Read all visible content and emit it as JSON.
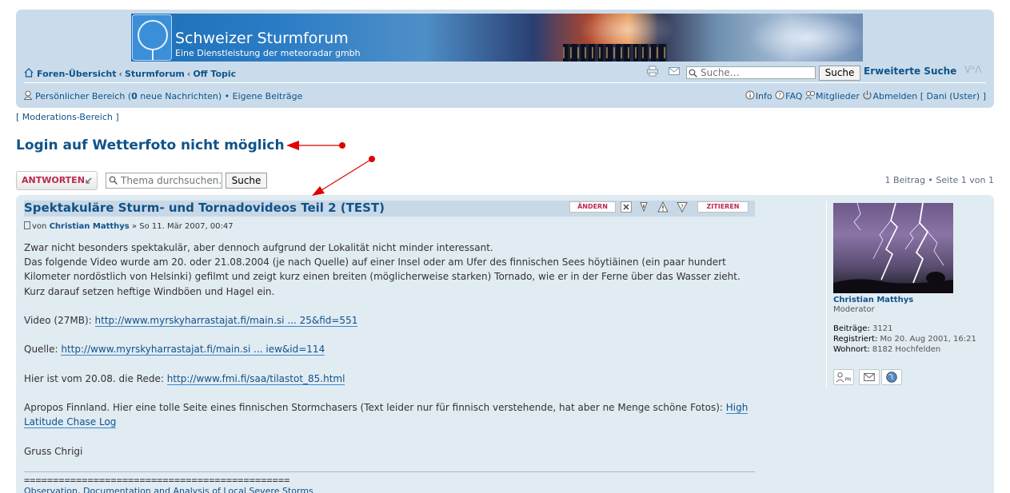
{
  "header": {
    "site_title": "Schweizer Sturmforum",
    "site_subtitle": "Eine Dienstleistung der meteoradar gmbh"
  },
  "breadcrumbs": {
    "home": "Foren-Übersicht",
    "sep": "‹",
    "forum": "Sturmforum",
    "subforum": "Off Topic"
  },
  "search": {
    "placeholder": "Suche…",
    "button": "Suche",
    "advanced": "Erweiterte Suche",
    "fontsize": "ᐯᴬᐱ"
  },
  "userbar": {
    "personal_area_prefix": "Persönlicher Bereich (",
    "new_messages_count": "0",
    "personal_area_suffix": " neue Nachrichten)",
    "bullet": " • ",
    "own_posts": "Eigene Beiträge",
    "info": "Info",
    "faq": "FAQ",
    "members": "Mitglieder",
    "logout": "Abmelden [ Dani (Uster) ]"
  },
  "moderation": "[ Moderations-Bereich ]",
  "topic": {
    "title": "Login auf Wetterfoto nicht möglich",
    "reply_button": "ANTWORTEN",
    "search_placeholder": "Thema durchsuchen…",
    "search_button": "Suche",
    "pagination": "1 Beitrag • Seite 1 von 1"
  },
  "post": {
    "title": "Spektakuläre Sturm- und Tornadovideos Teil 2 (TEST)",
    "buttons": {
      "edit": "ÄNDERN",
      "quote": "ZITIEREN"
    },
    "meta_prefix": "von ",
    "author": "Christian Matthys",
    "meta_date": " » So 11. Mär 2007, 00:47",
    "paragraph1_line1": "Zwar nicht besonders spektakulär, aber dennoch aufgrund der Lokalität nicht minder interessant.",
    "paragraph1_rest": "Das folgende Video wurde am 20. oder 21.08.2004 (je nach Quelle) auf einer Insel oder am Ufer des finnischen Sees höytiäinen (ein paar hundert Kilometer nordöstlich von Helsinki) gefilmt und zeigt kurz einen breiten (möglicherweise starken) Tornado, wie er in der Ferne über das Wasser zieht. Kurz darauf setzen heftige Windböen und Hagel ein.",
    "video_label": "Video (27MB): ",
    "video_link": "http://www.myrskyharrastajat.fi/main.si ... 25&fid=551",
    "source_label": "Quelle: ",
    "source_link": "http://www.myrskyharrastajat.fi/main.si ... iew&id=114",
    "talk_label": "Hier ist vom 20.08. die Rede: ",
    "talk_link": "http://www.fmi.fi/saa/tilastot_85.html",
    "finland_text": "Apropos Finnland. Hier eine tolle Seite eines finnischen Stormchasers (Text leider nur für finnisch verstehende, hat aber ne Menge schöne Fotos): ",
    "finland_link": "High Latitude Chase Log",
    "greeting": "Gruss Chrigi",
    "signature_rule": "==============================================",
    "signature_link": "Observation, Documentation and Analysis of Local Severe Storms"
  },
  "profile": {
    "name": "Christian Matthys",
    "rank": "Moderator",
    "posts_label": "Beiträge:",
    "posts_value": " 3121",
    "registered_label": "Registriert:",
    "registered_value": " Mo 20. Aug 2001, 16:21",
    "location_label": "Wohnort:",
    "location_value": " 8182 Hochfelden",
    "pm_label": "PN"
  },
  "colors": {
    "header_bg": "#cadceb",
    "link": "#105289",
    "post_bg": "#e1ebf2",
    "button_red": "#bc2a4d",
    "annotation_arrow": "#e00000"
  }
}
